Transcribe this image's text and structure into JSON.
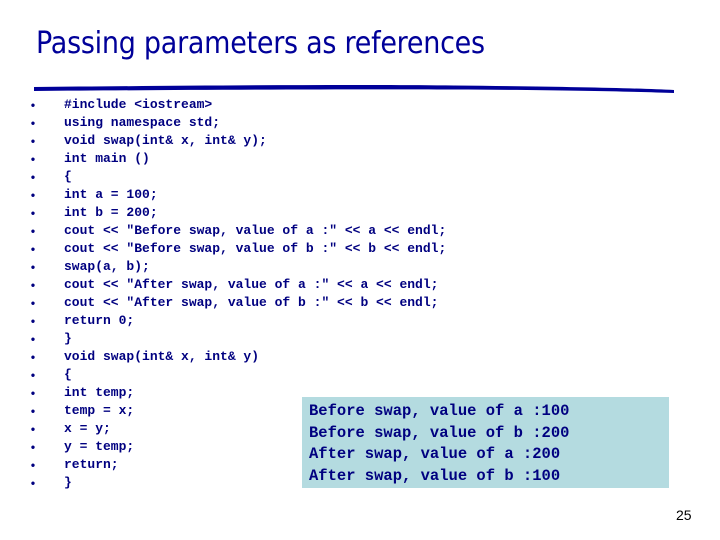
{
  "slide": {
    "title": "Passing parameters as references",
    "page_number": "25",
    "colors": {
      "title": "#000099",
      "code": "#000080",
      "output_background": "#b4dbe0"
    }
  },
  "code": {
    "bullet_glyph": "•",
    "lines": [
      "#include <iostream>",
      "using namespace std;",
      "void swap(int& x, int& y);",
      "int main ()",
      "{",
      "int a = 100;",
      "int b = 200;",
      "cout << \"Before swap, value of a :\" << a << endl;",
      "cout << \"Before swap, value of b :\" << b << endl;",
      "swap(a, b);",
      "cout << \"After swap, value of a :\" << a << endl;",
      "cout << \"After swap, value of b :\" << b << endl;",
      "return 0;",
      "}",
      "void swap(int& x, int& y)",
      "{",
      "int temp;",
      "temp = x;",
      "x = y;",
      "y = temp;",
      "return;",
      "}"
    ]
  },
  "output": {
    "lines": [
      "Before swap, value of a :100",
      "Before swap, value of b :200",
      "After swap, value of a :200",
      "After swap, value of b :100"
    ]
  }
}
